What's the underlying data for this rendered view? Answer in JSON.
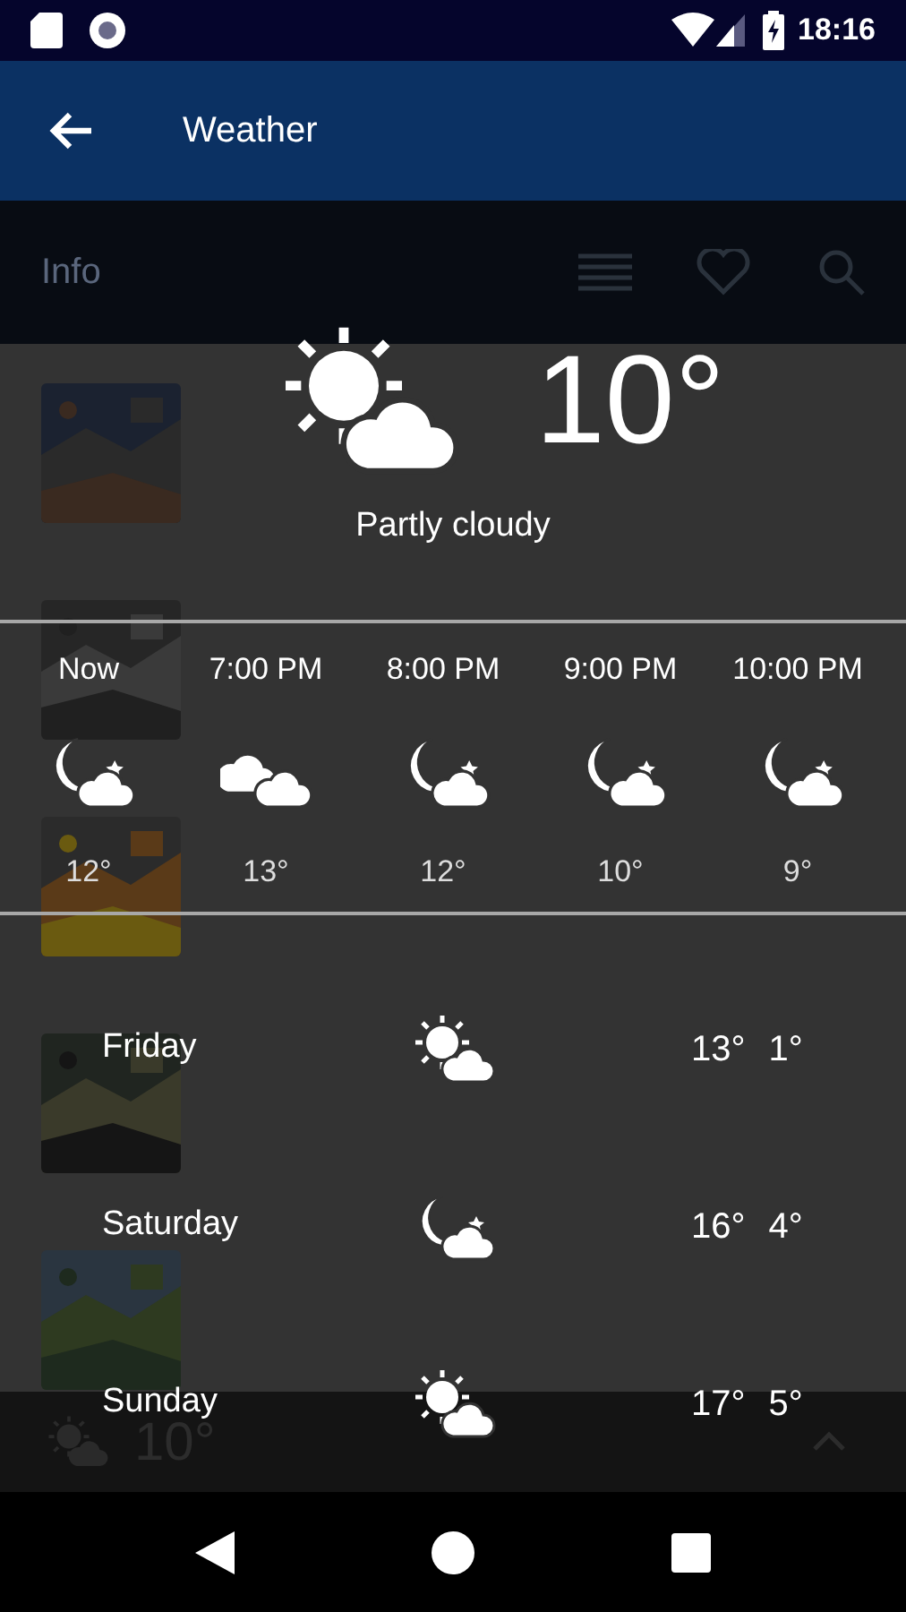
{
  "status_bar": {
    "time": "18:16"
  },
  "app_bar": {
    "title": "Weather"
  },
  "toolbar": {
    "title": "Info"
  },
  "bottom_bar": {
    "temperature": "10°"
  },
  "weather": {
    "current": {
      "kind": "partly_sunny",
      "temperature": "10°",
      "condition": "Partly cloudy"
    },
    "hourly": [
      {
        "time": "Now",
        "kind": "night_cloudy",
        "temperature": "12°"
      },
      {
        "time": "7:00 PM",
        "kind": "cloudy",
        "temperature": "13°"
      },
      {
        "time": "8:00 PM",
        "kind": "night_cloudy",
        "temperature": "12°"
      },
      {
        "time": "9:00 PM",
        "kind": "night_cloudy",
        "temperature": "10°"
      },
      {
        "time": "10:00 PM",
        "kind": "night_cloudy",
        "temperature": "9°"
      }
    ],
    "daily": [
      {
        "day": "Friday",
        "kind": "partly_sunny",
        "high": "13°",
        "low": "1°"
      },
      {
        "day": "Saturday",
        "kind": "night_cloudy",
        "high": "16°",
        "low": "4°"
      },
      {
        "day": "Sunday",
        "kind": "partly_sunny",
        "high": "17°",
        "low": "5°"
      }
    ]
  }
}
